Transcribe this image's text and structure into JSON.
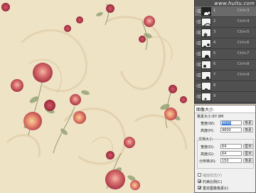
{
  "watermark": "www.huitu.com",
  "channels": [
    {
      "name": "1",
      "shortcut": "Ctrl+3"
    },
    {
      "name": "2",
      "shortcut": "Ctrl+4"
    },
    {
      "name": "3",
      "shortcut": "Ctrl+5"
    },
    {
      "name": "4",
      "shortcut": "Ctrl+6"
    },
    {
      "name": "5",
      "shortcut": "Ctrl+7"
    },
    {
      "name": "6",
      "shortcut": "Ctrl+8"
    },
    {
      "name": "7",
      "shortcut": "Ctrl+9"
    },
    {
      "name": "8",
      "shortcut": ""
    },
    {
      "name": "9",
      "shortcut": ""
    }
  ],
  "dialog": {
    "title": "图像大小",
    "pixel_size_label": "像素大小:87.9M",
    "width_label": "宽度(W):",
    "width_value": "9600",
    "width_unit": "像素",
    "height_label": "高度(H):",
    "height_value": "9600",
    "height_unit": "像素",
    "doc_size_label": "文档大小:",
    "doc_width_label": "宽度(D):",
    "doc_width_value": "64",
    "doc_width_unit": "厘米",
    "doc_height_label": "高度(G):",
    "doc_height_value": "64",
    "doc_height_unit": "厘米",
    "resolution_label": "分辨率(R):",
    "resolution_value": "150",
    "resolution_unit": "像素",
    "scale_styles": "缩放样式(Y)",
    "constrain": "约束比例(C)",
    "resample": "重定图像像素(I):"
  },
  "colors": {
    "panel_bg": "#505050",
    "selected_row": "#6a6a6a",
    "highlight": "#3a7bd5",
    "wallpaper_bg": "#efe3c6"
  }
}
